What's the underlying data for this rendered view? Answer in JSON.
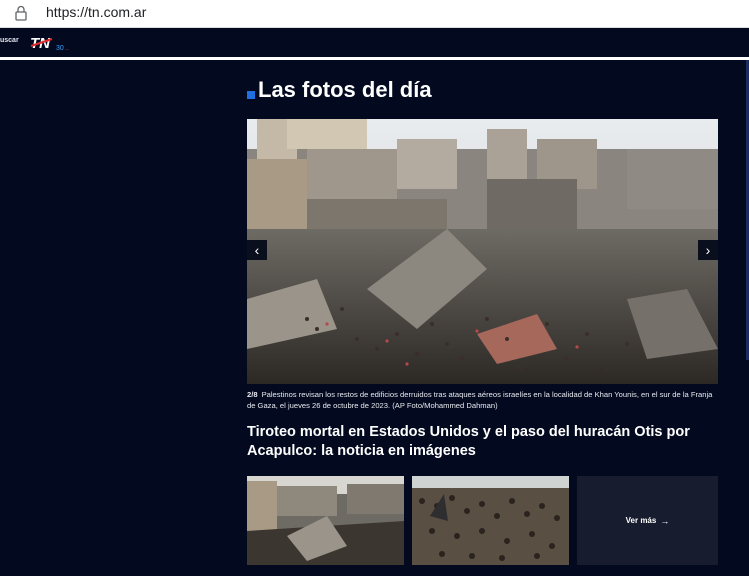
{
  "browser": {
    "url": "https://tn.com.ar",
    "lock_icon": "lock-icon"
  },
  "nav": {
    "search_label": "uscar",
    "logo_text": "TN",
    "logo_badge": "30"
  },
  "section": {
    "title": "Las fotos del día"
  },
  "gallery": {
    "counter": "2/8",
    "caption": "Palestinos revisan los restos de edificios derruidos tras ataques aéreos israelíes en la localidad de Khan Younis, en el sur de la Franja de Gaza, el jueves 26 de octubre de 2023. (AP Foto/Mohammed Dahman)",
    "prev_icon": "chevron-left-icon",
    "next_icon": "chevron-right-icon"
  },
  "headline": "Tiroteo mortal en Estados Unidos y el paso del huracán Otis por Acapulco: la noticia en imágenes",
  "more": {
    "label": "Ver más",
    "arrow": "→"
  },
  "colors": {
    "background": "#030a1f",
    "accent": "#1f6fe0"
  }
}
